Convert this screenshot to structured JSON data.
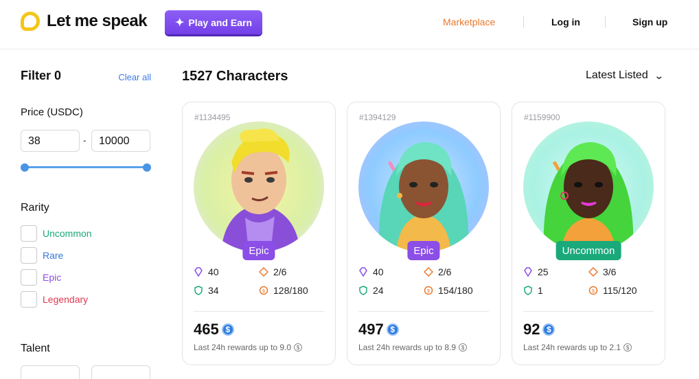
{
  "header": {
    "logo_text": "Let me speak",
    "play_button": "Play and Earn",
    "nav": {
      "marketplace": "Marketplace",
      "login": "Log in",
      "signup": "Sign up"
    },
    "accent_color": "#e8792e"
  },
  "sidebar": {
    "filter_title": "Filter 0",
    "clear_all": "Clear all",
    "price_label": "Price (USDC)",
    "price_min": "38",
    "price_max": "10000",
    "price_dash": "-",
    "rarity_label": "Rarity",
    "rarities": [
      {
        "label": "Uncommon",
        "color": "#1aa97a"
      },
      {
        "label": "Rare",
        "color": "#3a76d8"
      },
      {
        "label": "Epic",
        "color": "#8b4ee6"
      },
      {
        "label": "Legendary",
        "color": "#e0384f"
      }
    ],
    "talent_label": "Talent"
  },
  "main": {
    "count_title": "1527 Characters",
    "sort_label": "Latest Listed",
    "cards": [
      {
        "id": "#1134495",
        "rarity": "Epic",
        "rarity_color": "#8b4ee6",
        "gems": "40",
        "tickets": "2/6",
        "shield": "34",
        "energy": "128/180",
        "price": "465",
        "rewards": "Last 24h rewards up to 9.0"
      },
      {
        "id": "#1394129",
        "rarity": "Epic",
        "rarity_color": "#8b4ee6",
        "gems": "40",
        "tickets": "2/6",
        "shield": "24",
        "energy": "154/180",
        "price": "497",
        "rewards": "Last 24h rewards up to 8.9"
      },
      {
        "id": "#1159900",
        "rarity": "Uncommon",
        "rarity_color": "#1aa97a",
        "gems": "25",
        "tickets": "3/6",
        "shield": "1",
        "energy": "115/120",
        "price": "92",
        "rewards": "Last 24h rewards up to 2.1"
      }
    ]
  },
  "icons": {
    "gem": "gem-icon",
    "ticket": "ticket-icon",
    "shield": "shield-icon",
    "energy": "energy-icon",
    "coin": "usdc-coin-icon",
    "sort": "chevron-down-icon"
  }
}
